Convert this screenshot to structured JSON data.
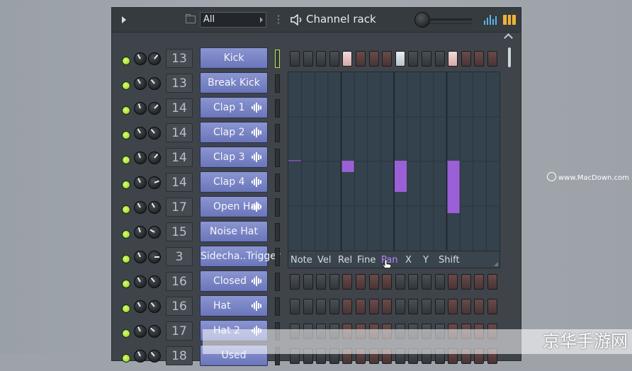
{
  "window": {
    "title": "Channel rack",
    "filter_value": "All"
  },
  "channels": [
    {
      "name": "Kick",
      "number": "13",
      "wave": false
    },
    {
      "name": "Break Kick",
      "number": "13",
      "wave": false
    },
    {
      "name": "Clap 1",
      "number": "14",
      "wave": true
    },
    {
      "name": "Clap 2",
      "number": "14",
      "wave": true
    },
    {
      "name": "Clap 3",
      "number": "14",
      "wave": true
    },
    {
      "name": "Clap 4",
      "number": "14",
      "wave": true
    },
    {
      "name": "Open Hat",
      "number": "17",
      "wave": true
    },
    {
      "name": "Noise Hat",
      "number": "15",
      "wave": false
    },
    {
      "name": "Sidecha..Trigger",
      "number": "3",
      "wave": false
    },
    {
      "name": "Closed Hat",
      "number": "16",
      "wave": true
    },
    {
      "name": "Hat",
      "number": "16",
      "wave": true
    },
    {
      "name": "Hat 2",
      "number": "17",
      "wave": true
    },
    {
      "name": "Used",
      "number": "18",
      "wave": false
    }
  ],
  "editor": {
    "tabs": [
      "Note",
      "Vel",
      "Rel",
      "Fine",
      "Pan",
      "X",
      "Y",
      "Shift"
    ],
    "active_tab": "Pan"
  },
  "watermark": {
    "site": "www.MacDown.com",
    "banner": "京华手游网"
  },
  "colors": {
    "accent_led": "#a8e63a",
    "channel_button": "#7c87c8",
    "pan_bar": "#9b5fd6"
  }
}
